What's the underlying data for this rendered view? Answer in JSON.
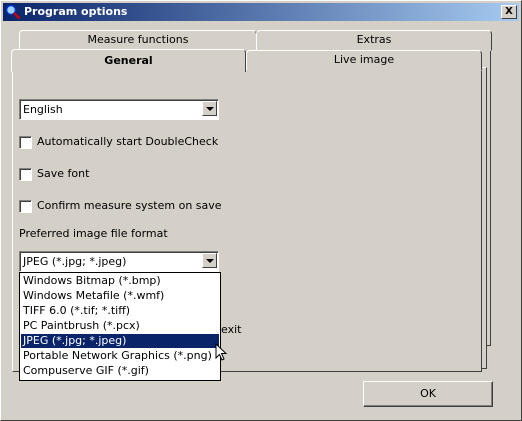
{
  "window": {
    "title": "Program options",
    "close_label": "X"
  },
  "tabs": {
    "measure_functions": "Measure functions",
    "extras": "Extras",
    "general": "General",
    "live_image": "Live image"
  },
  "general": {
    "language_value": "English",
    "checkboxes": [
      {
        "label": "Automatically start DoubleCheck",
        "checked": false
      },
      {
        "label": "Save font",
        "checked": false
      },
      {
        "label": "Confirm measure system on save",
        "checked": false
      }
    ],
    "format_label": "Preferred image file format",
    "format_value": "JPEG (*.jpg; *.jpeg)",
    "format_options": [
      "Windows Bitmap (*.bmp)",
      "Windows Metafile (*.wmf)",
      "TIFF 6.0 (*.tif; *.tiff)",
      "PC Paintbrush (*.pcx)",
      "JPEG (*.jpg; *.jpeg)",
      "Portable Network Graphics (*.png)",
      "Compuserve GIF (*.gif)"
    ],
    "selected_option_index": 4,
    "hidden_fragment": "exit"
  },
  "buttons": {
    "ok": "OK"
  },
  "colors": {
    "title_start": "#0a246a",
    "title_end": "#a6caf0",
    "selection": "#0a246a"
  }
}
